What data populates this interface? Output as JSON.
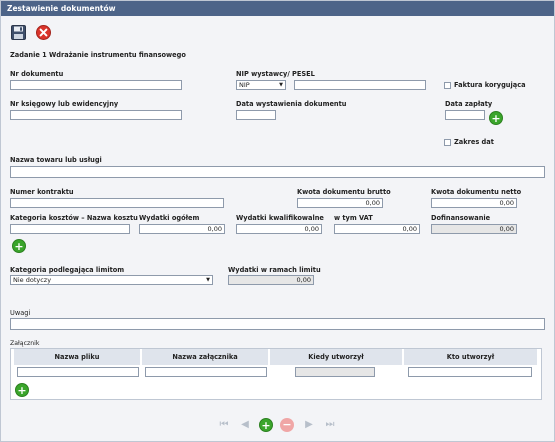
{
  "header": {
    "title": "Zestawienie dokumentów"
  },
  "task": "Zadanie 1 Wdrażanie instrumentu finansowego",
  "fields": {
    "nr_dokumentu": {
      "label": "Nr dokumentu",
      "value": ""
    },
    "nip": {
      "label": "NIP wystawcy/ PESEL",
      "type_selected": "NIP",
      "value": ""
    },
    "faktura_korygujaca": {
      "label": "Faktura korygująca",
      "checked": false
    },
    "nr_ksiegowy": {
      "label": "Nr księgowy lub ewidencyjny",
      "value": ""
    },
    "data_wystawienia": {
      "label": "Data wystawienia dokumentu",
      "value": ""
    },
    "data_zaplaty": {
      "label": "Data zapłaty",
      "value": ""
    },
    "zakres_dat": {
      "label": "Zakres dat",
      "checked": false
    },
    "nazwa_towaru": {
      "label": "Nazwa towaru lub usługi",
      "value": ""
    },
    "numer_kontraktu": {
      "label": "Numer kontraktu",
      "value": ""
    },
    "kwota_brutto": {
      "label": "Kwota dokumentu brutto",
      "value": "0,00"
    },
    "kwota_netto": {
      "label": "Kwota dokumentu netto",
      "value": "0,00"
    },
    "kategoria_kosztow": {
      "label": "Kategoria kosztów – Nazwa kosztu",
      "value": ""
    },
    "wydatki_ogolem": {
      "label": "Wydatki ogółem",
      "value": "0,00"
    },
    "wydatki_kwalifikowalne": {
      "label": "Wydatki kwalifikowalne",
      "value": "0,00"
    },
    "w_tym_vat": {
      "label": "w tym VAT",
      "value": "0,00"
    },
    "dofinansowanie": {
      "label": "Dofinansowanie",
      "value": "0,00"
    },
    "kategoria_limitom": {
      "label": "Kategoria podlegająca limitom",
      "value": "Nie dotyczy"
    },
    "wydatki_limit": {
      "label": "Wydatki w ramach limitu",
      "value": "0,00"
    },
    "uwagi": {
      "label": "Uwagi",
      "value": ""
    }
  },
  "attachments": {
    "label": "Załącznik",
    "columns": [
      "Nazwa pliku",
      "Nazwa załącznika",
      "Kiedy utworzył",
      "Kto utworzył"
    ]
  },
  "icons": {
    "save": "floppy-disk-icon",
    "close": "red-x-icon",
    "add": "green-plus-icon",
    "remove": "red-minus-icon"
  },
  "colors": {
    "header": "#4d6488",
    "add": "#3aa52b",
    "close": "#d9342b"
  }
}
